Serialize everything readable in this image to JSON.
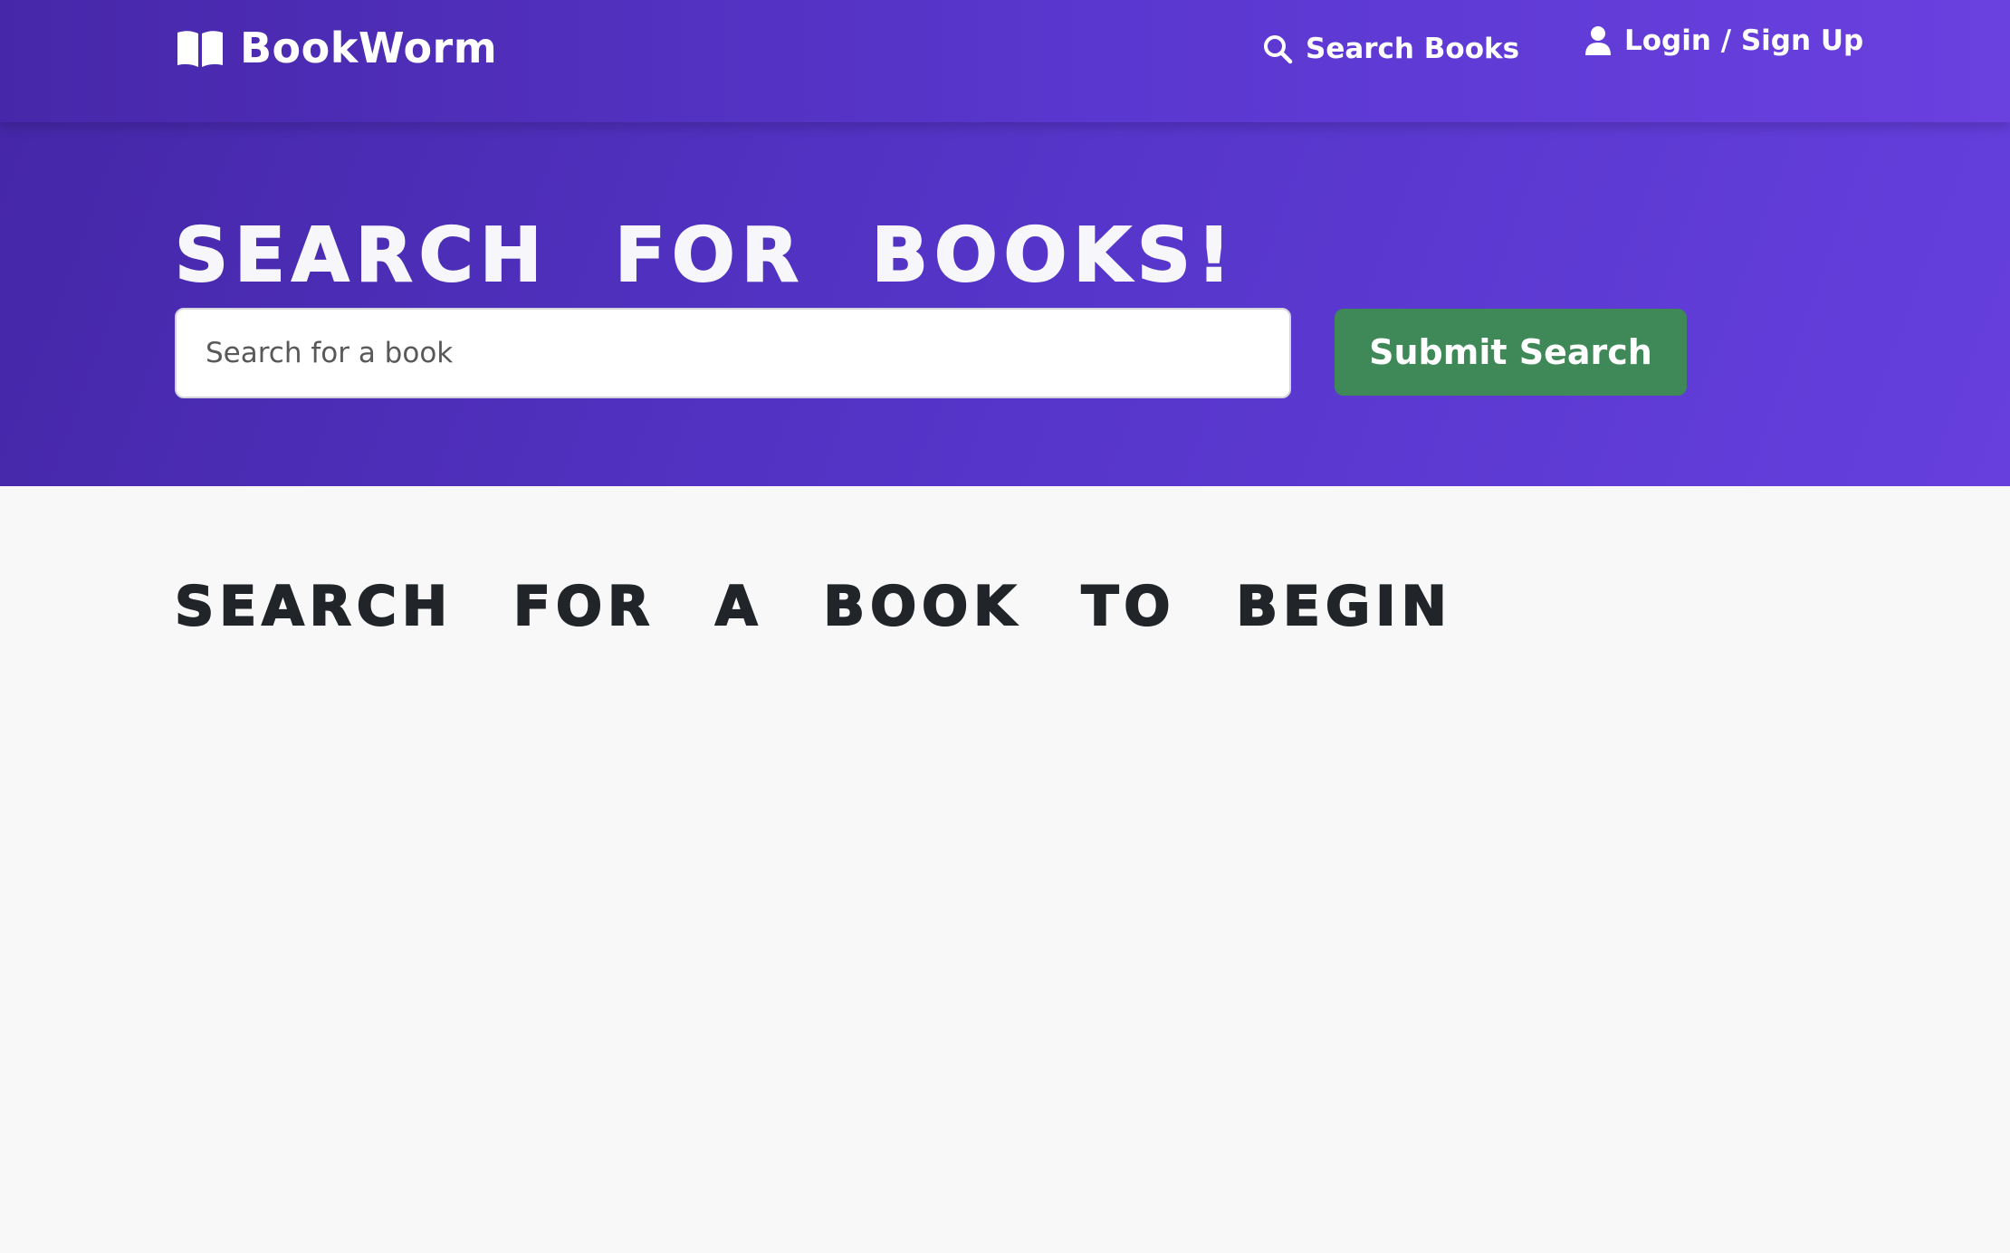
{
  "app": {
    "brand_name": "BookWorm",
    "brand_icon": "open-book-icon"
  },
  "nav": {
    "search_label": "Search Books",
    "search_icon": "search-icon",
    "login_label": "Login / Sign Up",
    "login_icon": "user-icon"
  },
  "hero": {
    "title": "Search for Books!",
    "search_placeholder": "Search for a book",
    "search_value": "",
    "submit_label": "Submit Search"
  },
  "results": {
    "heading": "Search for a book to begin"
  },
  "colors": {
    "header_gradient_start": "#4527a8",
    "header_gradient_end": "#663fdd",
    "submit_button": "#3f8858",
    "page_background": "#f8f8f8",
    "heading_text": "#212529"
  }
}
